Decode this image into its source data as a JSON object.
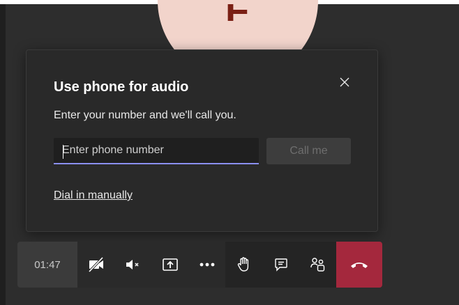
{
  "participant": {
    "initial": "E"
  },
  "dialog": {
    "title": "Use phone for audio",
    "subtitle": "Enter your number and we'll call you.",
    "phone_input": {
      "placeholder": "Enter phone number",
      "value": ""
    },
    "call_button_label": "Call me",
    "dial_in_link": "Dial in manually",
    "close_icon": "close-icon"
  },
  "toolbar": {
    "call_duration": "01:47",
    "buttons": [
      {
        "name": "camera-off",
        "icon": "camera-off-icon"
      },
      {
        "name": "mute",
        "icon": "speaker-mute-icon"
      },
      {
        "name": "share",
        "icon": "share-screen-icon"
      },
      {
        "name": "more",
        "icon": "more-icon"
      },
      {
        "name": "raise-hand",
        "icon": "raise-hand-icon"
      },
      {
        "name": "chat",
        "icon": "chat-icon"
      },
      {
        "name": "participants",
        "icon": "participants-icon"
      },
      {
        "name": "hang-up",
        "icon": "hang-up-icon"
      }
    ]
  },
  "colors": {
    "accent_underline": "#8a8ff0",
    "hangup": "#a4283d",
    "avatar_bg": "#f2d4cb",
    "avatar_text": "#7a1f14"
  }
}
